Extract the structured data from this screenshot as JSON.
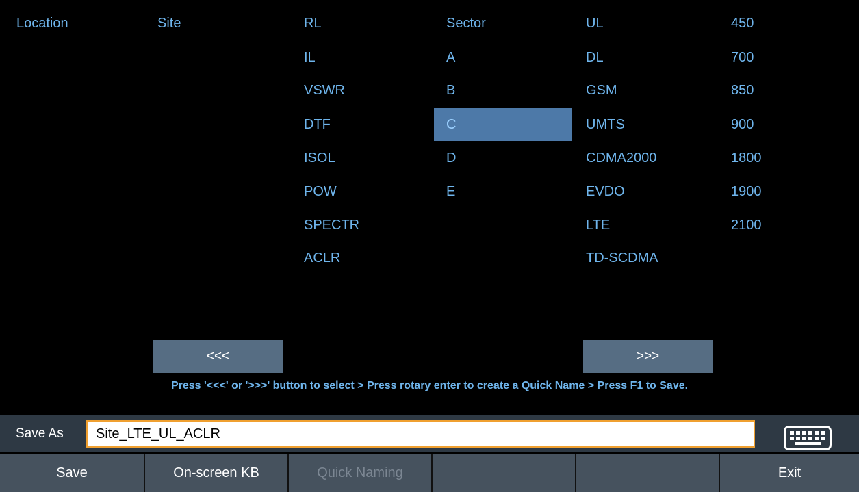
{
  "headers": {
    "location": "Location",
    "site": "Site",
    "measurement": "RL",
    "sector": "Sector",
    "technology": "UL",
    "frequency": "450"
  },
  "measurements": [
    "IL",
    "VSWR",
    "DTF",
    "ISOL",
    "POW",
    "SPECTR",
    "ACLR"
  ],
  "sectors": [
    "A",
    "B",
    "C",
    "D",
    "E"
  ],
  "selected_sector": "C",
  "technologies": [
    "DL",
    "GSM",
    "UMTS",
    "CDMA2000",
    "EVDO",
    "LTE",
    "TD-SCDMA"
  ],
  "frequencies": [
    "700",
    "850",
    "900",
    "1800",
    "1900",
    "2100"
  ],
  "nav": {
    "prev_label": "<<<",
    "next_label": ">>>"
  },
  "hint": "Press '<<<' or '>>>' button to select > Press rotary enter to create a Quick Name > Press F1 to Save.",
  "save_as": {
    "label": "Save As",
    "value": "Site_LTE_UL_ACLR"
  },
  "softkeys": [
    "Save",
    "On-screen KB",
    "Quick Naming",
    "",
    "",
    "Exit"
  ],
  "colors": {
    "background": "#000000",
    "text": "#6fb5ec",
    "selection": "#4d79a8",
    "button": "#566d83",
    "input_border": "#f0a030"
  }
}
